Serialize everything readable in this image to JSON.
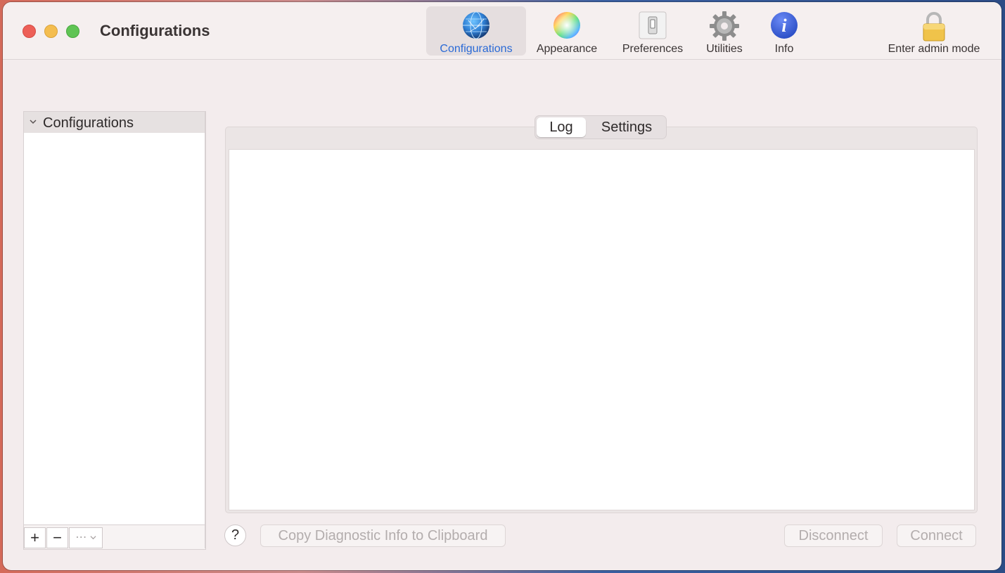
{
  "window": {
    "title": "Configurations"
  },
  "toolbar": {
    "items": [
      {
        "label": "Configurations",
        "icon": "globe-icon",
        "selected": true
      },
      {
        "label": "Appearance",
        "icon": "color-wheel-icon",
        "selected": false
      },
      {
        "label": "Preferences",
        "icon": "switch-icon",
        "selected": false
      },
      {
        "label": "Utilities",
        "icon": "gear-icon",
        "selected": false
      },
      {
        "label": "Info",
        "icon": "info-icon",
        "selected": false
      }
    ],
    "admin_label": "Enter admin mode",
    "admin_icon": "lock-icon"
  },
  "sidebar": {
    "header": "Configurations",
    "add_label": "+",
    "remove_label": "−",
    "more_label": "⋯"
  },
  "tabs": [
    {
      "label": "Log",
      "active": true
    },
    {
      "label": "Settings",
      "active": false
    }
  ],
  "footer": {
    "help_label": "?",
    "copy_label": "Copy Diagnostic Info to Clipboard",
    "disconnect_label": "Disconnect",
    "connect_label": "Connect"
  },
  "colors": {
    "accent": "#2a6ad6",
    "window_bg": "#f3eced",
    "disabled_text": "#b3adad"
  }
}
